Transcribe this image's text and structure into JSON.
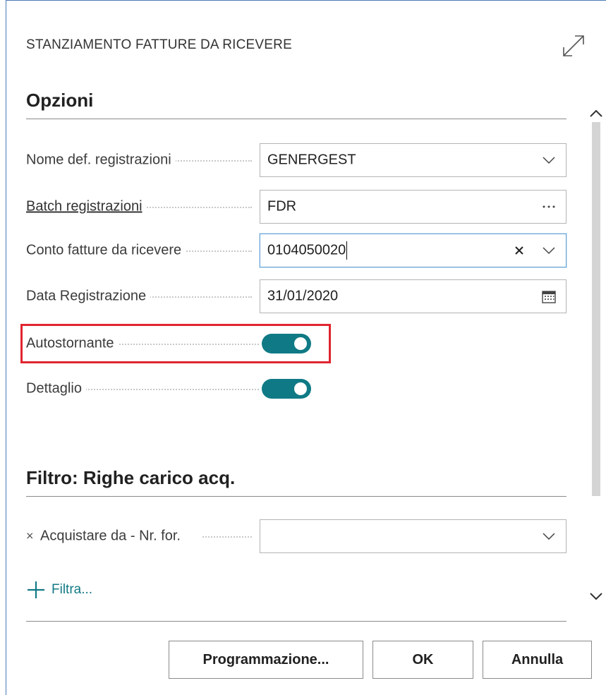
{
  "dialog": {
    "title": "STANZIAMENTO FATTURE DA RICEVERE"
  },
  "options": {
    "heading": "Opzioni",
    "fields": [
      {
        "label": "Nome def. registrazioni",
        "value": "GENERGEST"
      },
      {
        "label": "Batch registrazioni",
        "value": "FDR"
      },
      {
        "label": "Conto fatture da ricevere",
        "value": "0104050020"
      },
      {
        "label": "Data Registrazione",
        "value": "31/01/2020"
      }
    ],
    "toggles": [
      {
        "label": "Autostornante",
        "on": true
      },
      {
        "label": "Dettaglio",
        "on": true
      }
    ]
  },
  "filter": {
    "heading": "Filtro: Righe carico acq.",
    "field_label": "Acquistare da - Nr. for.",
    "field_value": "",
    "add_label": "Filtra..."
  },
  "buttons": {
    "schedule": "Programmazione...",
    "ok": "OK",
    "cancel": "Annulla"
  },
  "colors": {
    "accent": "#0f7a85",
    "highlight": "#e0252f",
    "focus_border": "#6aa3d5"
  },
  "icons": {
    "expand": "expand-icon",
    "dropdown": "chevron-down-icon",
    "lookup": "ellipsis-icon",
    "clear": "close-icon",
    "calendar": "calendar-icon",
    "add": "plus-icon",
    "scroll_up": "chevron-up-icon",
    "scroll_down": "chevron-down-icon"
  }
}
